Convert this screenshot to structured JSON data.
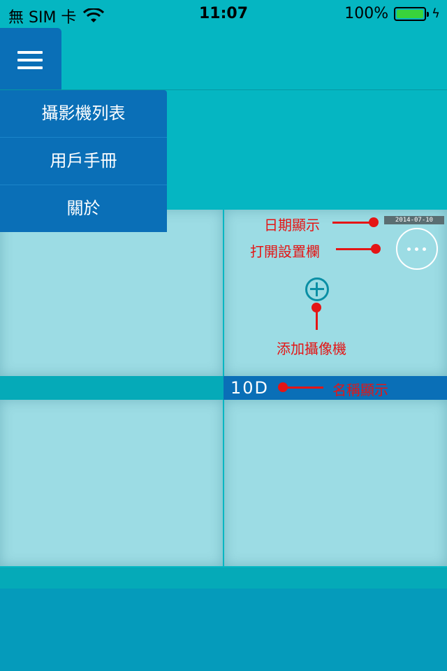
{
  "status_bar": {
    "carrier": "無 SIM 卡",
    "time": "11:07",
    "battery_percent": "100%",
    "battery_color": "#39d33b"
  },
  "menu": {
    "icon": "hamburger-menu-icon",
    "items": [
      {
        "label": "攝影機列表"
      },
      {
        "label": "用戶手冊"
      },
      {
        "label": "關於"
      }
    ]
  },
  "camera": {
    "name": "10D",
    "timestamp": "2014-07-10 14:06:01",
    "settings_icon": "more-dots-icon",
    "add_icon": "plus-circle-icon"
  },
  "annotations": {
    "date_display": "日期顯示",
    "open_settings": "打開設置欄",
    "add_camera": "添加攝像機",
    "name_display": "名稱顯示"
  },
  "colors": {
    "background": "#05b6c2",
    "menu": "#0a6fb7",
    "cell": "#9cdce4",
    "annotation": "#e41515"
  }
}
